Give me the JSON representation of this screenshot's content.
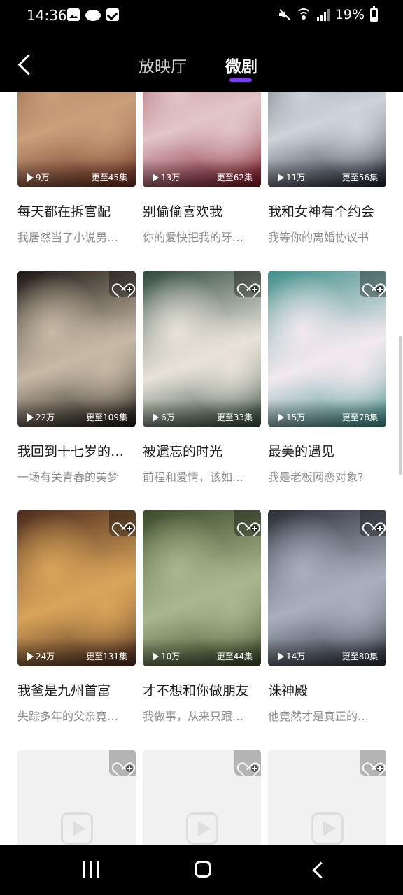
{
  "status_bar": {
    "time": "14:36",
    "battery": "19%",
    "icons": [
      "photo-icon",
      "cloud-icon",
      "check-icon",
      "mute-icon",
      "wifi-icon",
      "signal-icon",
      "battery-icon"
    ]
  },
  "header": {
    "tabs": [
      {
        "label": "放映厅",
        "active": false
      },
      {
        "label": "微剧",
        "active": true
      }
    ],
    "accent_color": "#7a3cf0"
  },
  "cards": [
    {
      "title": "每天都在拆官配",
      "desc": "我居然当了小说男…",
      "plays": "9万",
      "episodes": "更至45集",
      "colors": [
        "#6b2a1f",
        "#c9a07a"
      ]
    },
    {
      "title": "别偷偷喜欢我",
      "desc": "你的爱快把我的牙…",
      "plays": "13万",
      "episodes": "更至62集",
      "colors": [
        "#7a1020",
        "#e2c6c8"
      ]
    },
    {
      "title": "我和女神有个约会",
      "desc": "我等你的离婚协议书",
      "plays": "11万",
      "episodes": "更至56集",
      "colors": [
        "#1d2330",
        "#cfd3da"
      ]
    },
    {
      "title": "我回到十七岁的…",
      "desc": "一场有关青春的美梦",
      "plays": "22万",
      "episodes": "更至109集",
      "colors": [
        "#1a1612",
        "#c7b9a5"
      ]
    },
    {
      "title": "被遗忘的时光",
      "desc": "前程和爱情，该如…",
      "plays": "6万",
      "episodes": "更至33集",
      "colors": [
        "#2f4a3c",
        "#e8e3d8"
      ]
    },
    {
      "title": "最美的遇见",
      "desc": "我是老板网恋对象?",
      "plays": "15万",
      "episodes": "更至78集",
      "colors": [
        "#3f8f8a",
        "#f2e9ee"
      ]
    },
    {
      "title": "我爸是九州首富",
      "desc": "失踪多年的父亲竟…",
      "plays": "24万",
      "episodes": "更至131集",
      "colors": [
        "#4a2a1c",
        "#d9a45a"
      ]
    },
    {
      "title": "才不想和你做朋友",
      "desc": "我做事，从来只跟…",
      "plays": "10万",
      "episodes": "更至44集",
      "colors": [
        "#3a4a2a",
        "#a7b88e"
      ]
    },
    {
      "title": "诛神殿",
      "desc": "他竟然才是真正的…",
      "plays": "14万",
      "episodes": "更至80集",
      "colors": [
        "#2a2d36",
        "#a8b0bf"
      ]
    }
  ],
  "placeholder_cards": 3
}
